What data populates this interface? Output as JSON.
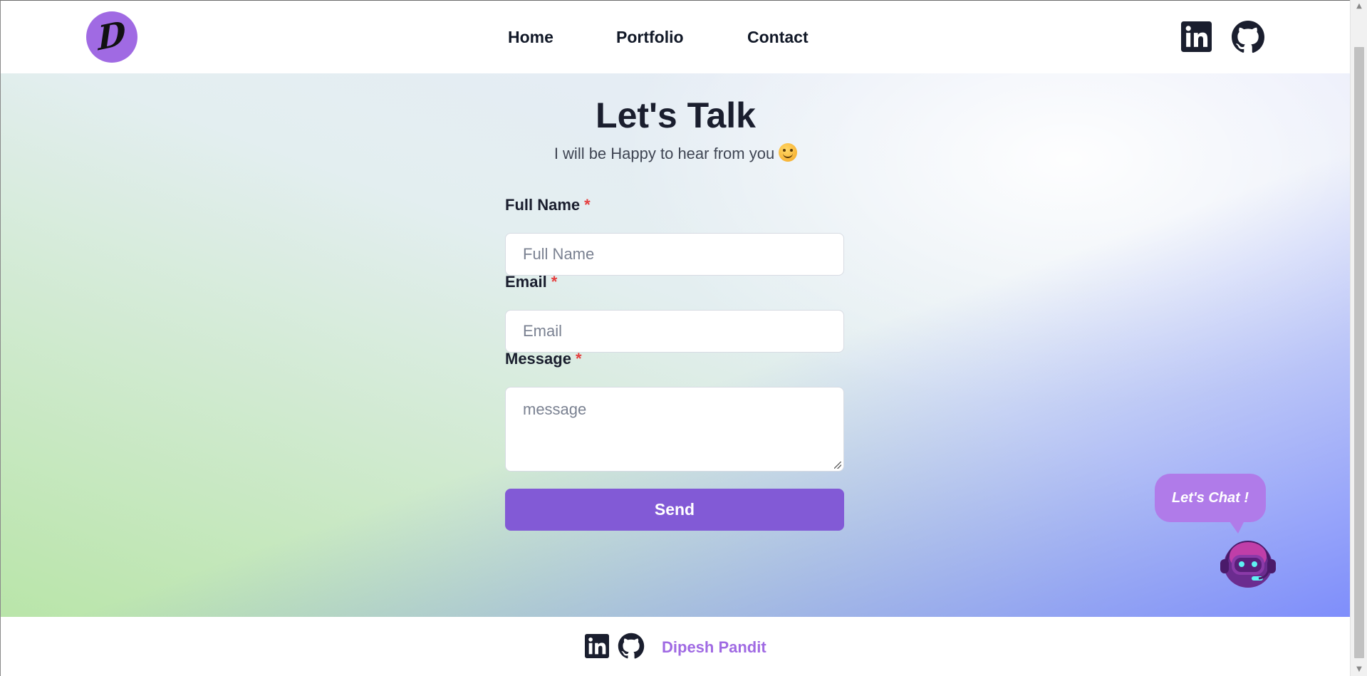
{
  "header": {
    "logo_alt": "D",
    "nav": {
      "home": "Home",
      "portfolio": "Portfolio",
      "contact": "Contact"
    },
    "icons": [
      "linkedin-icon",
      "github-icon"
    ]
  },
  "hero": {
    "title": "Let's Talk",
    "subtitle": "I will be Happy to hear from you"
  },
  "form": {
    "full_name": {
      "label": "Full Name",
      "required_mark": "*",
      "placeholder": "Full Name",
      "value": ""
    },
    "email": {
      "label": "Email",
      "required_mark": "*",
      "placeholder": "Email",
      "value": ""
    },
    "message": {
      "label": "Message",
      "required_mark": "*",
      "placeholder": "message",
      "value": ""
    },
    "submit_label": "Send"
  },
  "chat_widget": {
    "bubble_text": "Let's Chat !"
  },
  "footer": {
    "name": "Dipesh Pandit",
    "icons": [
      "linkedin-icon",
      "github-icon"
    ]
  },
  "colors": {
    "accent": "#825ad6",
    "brand_purple": "#a06ae3",
    "required": "#e53e3e",
    "text_dark": "#1a1e2e"
  }
}
